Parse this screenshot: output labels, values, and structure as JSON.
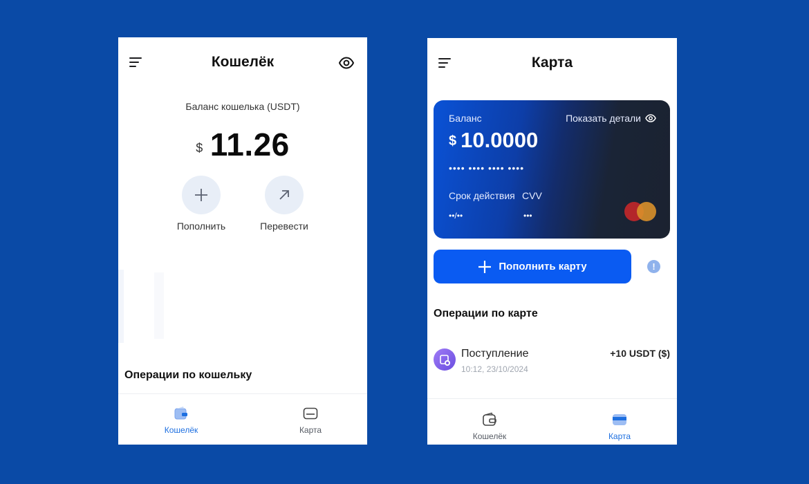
{
  "wallet_screen": {
    "title": "Кошелёк",
    "balance_label": "Баланс кошелька (USDT)",
    "balance_currency": "$",
    "balance_amount": "11.26",
    "actions": [
      {
        "label": "Пополнить",
        "icon": "plus-icon"
      },
      {
        "label": "Перевести",
        "icon": "arrow-up-right-icon"
      }
    ],
    "operations_title": "Операции по кошельку",
    "tabs": [
      {
        "label": "Кошелёк",
        "icon": "wallet-icon",
        "active": true
      },
      {
        "label": "Карта",
        "icon": "card-icon",
        "active": false
      }
    ]
  },
  "card_screen": {
    "title": "Карта",
    "card": {
      "balance_label": "Баланс",
      "show_details_label": "Показать детали",
      "currency": "$",
      "amount": "10.0000",
      "masked_number": "•••• •••• •••• ••••",
      "expiry_label": "Срок действия",
      "cvv_label": "CVV",
      "expiry_value": "••/••",
      "cvv_value": "•••"
    },
    "topup_button_label": "Пополнить карту",
    "operations_title": "Операции по карте",
    "operations": [
      {
        "title": "Поступление",
        "time": "10:12, 23/10/2024",
        "amount": "+10 USDT ($)"
      }
    ],
    "tabs": [
      {
        "label": "Кошелёк",
        "icon": "wallet-icon",
        "active": false
      },
      {
        "label": "Карта",
        "icon": "card-icon",
        "active": true
      }
    ]
  },
  "colors": {
    "background": "#0a4aa6",
    "accent": "#0a5bf2",
    "active_tab": "#1d6fe0",
    "inactive_tab": "#555a63"
  }
}
